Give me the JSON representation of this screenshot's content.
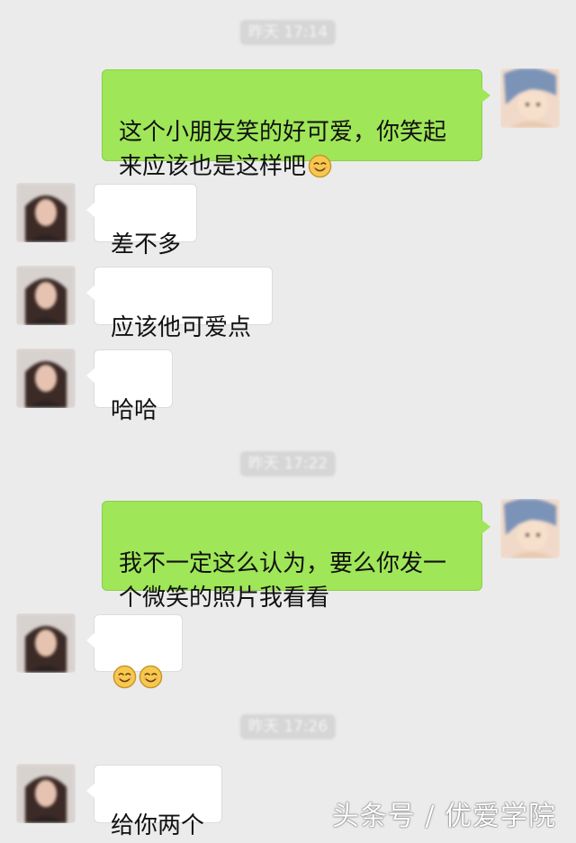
{
  "timestamps": [
    "昨天 17:14",
    "昨天 17:22",
    "昨天 17:26"
  ],
  "messages": [
    {
      "from": "me",
      "text": "这个小朋友笑的好可爱，你笑起\n来应该也是这样吧",
      "emoji": [
        "smile-emoji"
      ]
    },
    {
      "from": "friend",
      "text": "差不多",
      "emoji": []
    },
    {
      "from": "friend",
      "text": "应该他可爱点",
      "emoji": []
    },
    {
      "from": "friend",
      "text": "哈哈",
      "emoji": []
    },
    {
      "from": "me",
      "text": "我不一定这么认为，要么你发一\n个微笑的照片我看看",
      "emoji": []
    },
    {
      "from": "friend",
      "text": "",
      "emoji": [
        "smile-emoji",
        "smile-emoji"
      ]
    },
    {
      "from": "friend",
      "text": "给你两个",
      "emoji": []
    }
  ],
  "watermark": "头条号 / 优爱学院",
  "colors": {
    "background": "#ebebeb",
    "outgoing_bubble": "#9fe658",
    "incoming_bubble": "#ffffff",
    "timestamp_pill": "#d6d6d6"
  }
}
